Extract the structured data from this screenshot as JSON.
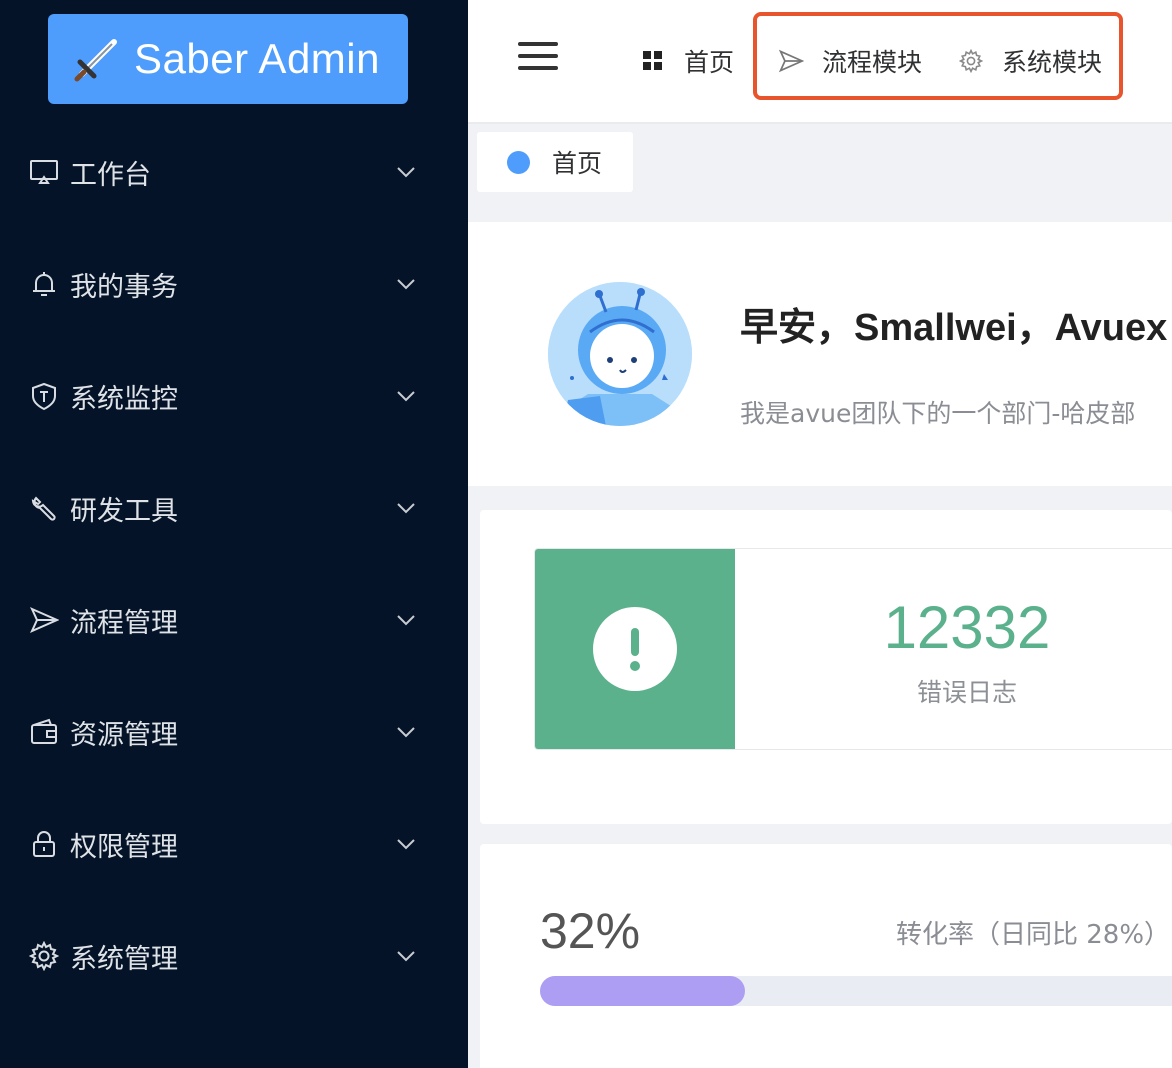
{
  "app": {
    "title": "Saber Admin"
  },
  "sidebar": {
    "items": [
      {
        "label": "工作台",
        "icon": "monitor-icon"
      },
      {
        "label": "我的事务",
        "icon": "bell-icon"
      },
      {
        "label": "系统监控",
        "icon": "shield-icon"
      },
      {
        "label": "研发工具",
        "icon": "wrench-icon"
      },
      {
        "label": "流程管理",
        "icon": "send-icon"
      },
      {
        "label": "资源管理",
        "icon": "wallet-icon"
      },
      {
        "label": "权限管理",
        "icon": "lock-icon"
      },
      {
        "label": "系统管理",
        "icon": "gear-icon"
      }
    ]
  },
  "header": {
    "nav": [
      {
        "label": "首页",
        "icon": "grid-icon"
      },
      {
        "label": "流程模块",
        "icon": "send-icon"
      },
      {
        "label": "系统模块",
        "icon": "gear-icon"
      }
    ]
  },
  "tags": [
    {
      "label": "首页",
      "active": true
    }
  ],
  "welcome": {
    "greeting": "早安，Smallwei，Avuex",
    "subtitle": "我是avue团队下的一个部门-哈皮部"
  },
  "stat": {
    "value": "12332",
    "label": "错误日志",
    "color": "#5bb18c"
  },
  "progress": {
    "percent_label": "32%",
    "rate_label": "转化率（日同比 28%）",
    "fill": 0.32,
    "color": "#ad9ef4"
  },
  "colors": {
    "sidebar_bg": "#041327",
    "accent": "#4e9cfb",
    "highlight": "#e8542b"
  }
}
